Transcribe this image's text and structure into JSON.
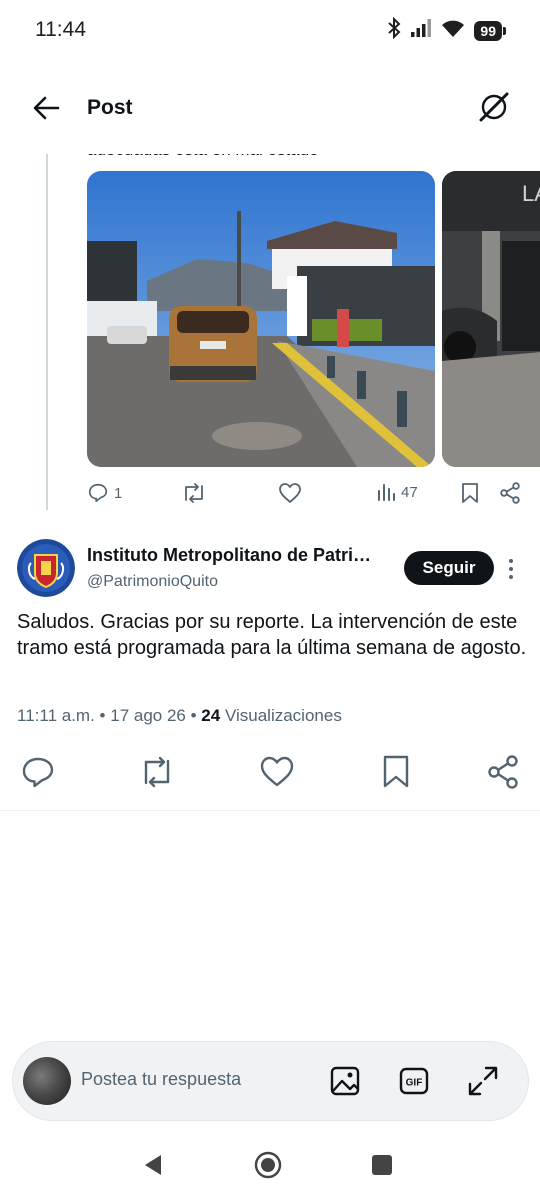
{
  "status_bar": {
    "time": "11:44",
    "battery": "99"
  },
  "header": {
    "title": "Post"
  },
  "previous_post": {
    "partial_text": "adecuadas está en mal estado",
    "actions": {
      "replies": "1",
      "views": "47"
    }
  },
  "reply_post": {
    "author_name": "Instituto Metropolitano de Patri…",
    "author_handle": "@PatrimonioQuito",
    "follow_label": "Seguir",
    "text": "Saludos. Gracias por su reporte. La intervención de este tramo está programada para la última semana de agosto.",
    "time": "11:11 a.m.",
    "date": "17 ago 26",
    "views_count": "24",
    "views_label": "Visualizaciones"
  },
  "composer": {
    "placeholder": "Postea tu respuesta"
  },
  "icons": {
    "back": "arrow-left-icon",
    "grok": "grok-icon",
    "reply": "reply-icon",
    "repost": "repost-icon",
    "like": "heart-icon",
    "views": "bar-chart-icon",
    "bookmark": "bookmark-icon",
    "share": "share-icon",
    "image": "image-icon",
    "gif": "gif-icon",
    "expand": "expand-icon"
  },
  "colors": {
    "accent": "#0f1419",
    "muted": "#536471",
    "divider": "#eff3f4"
  }
}
